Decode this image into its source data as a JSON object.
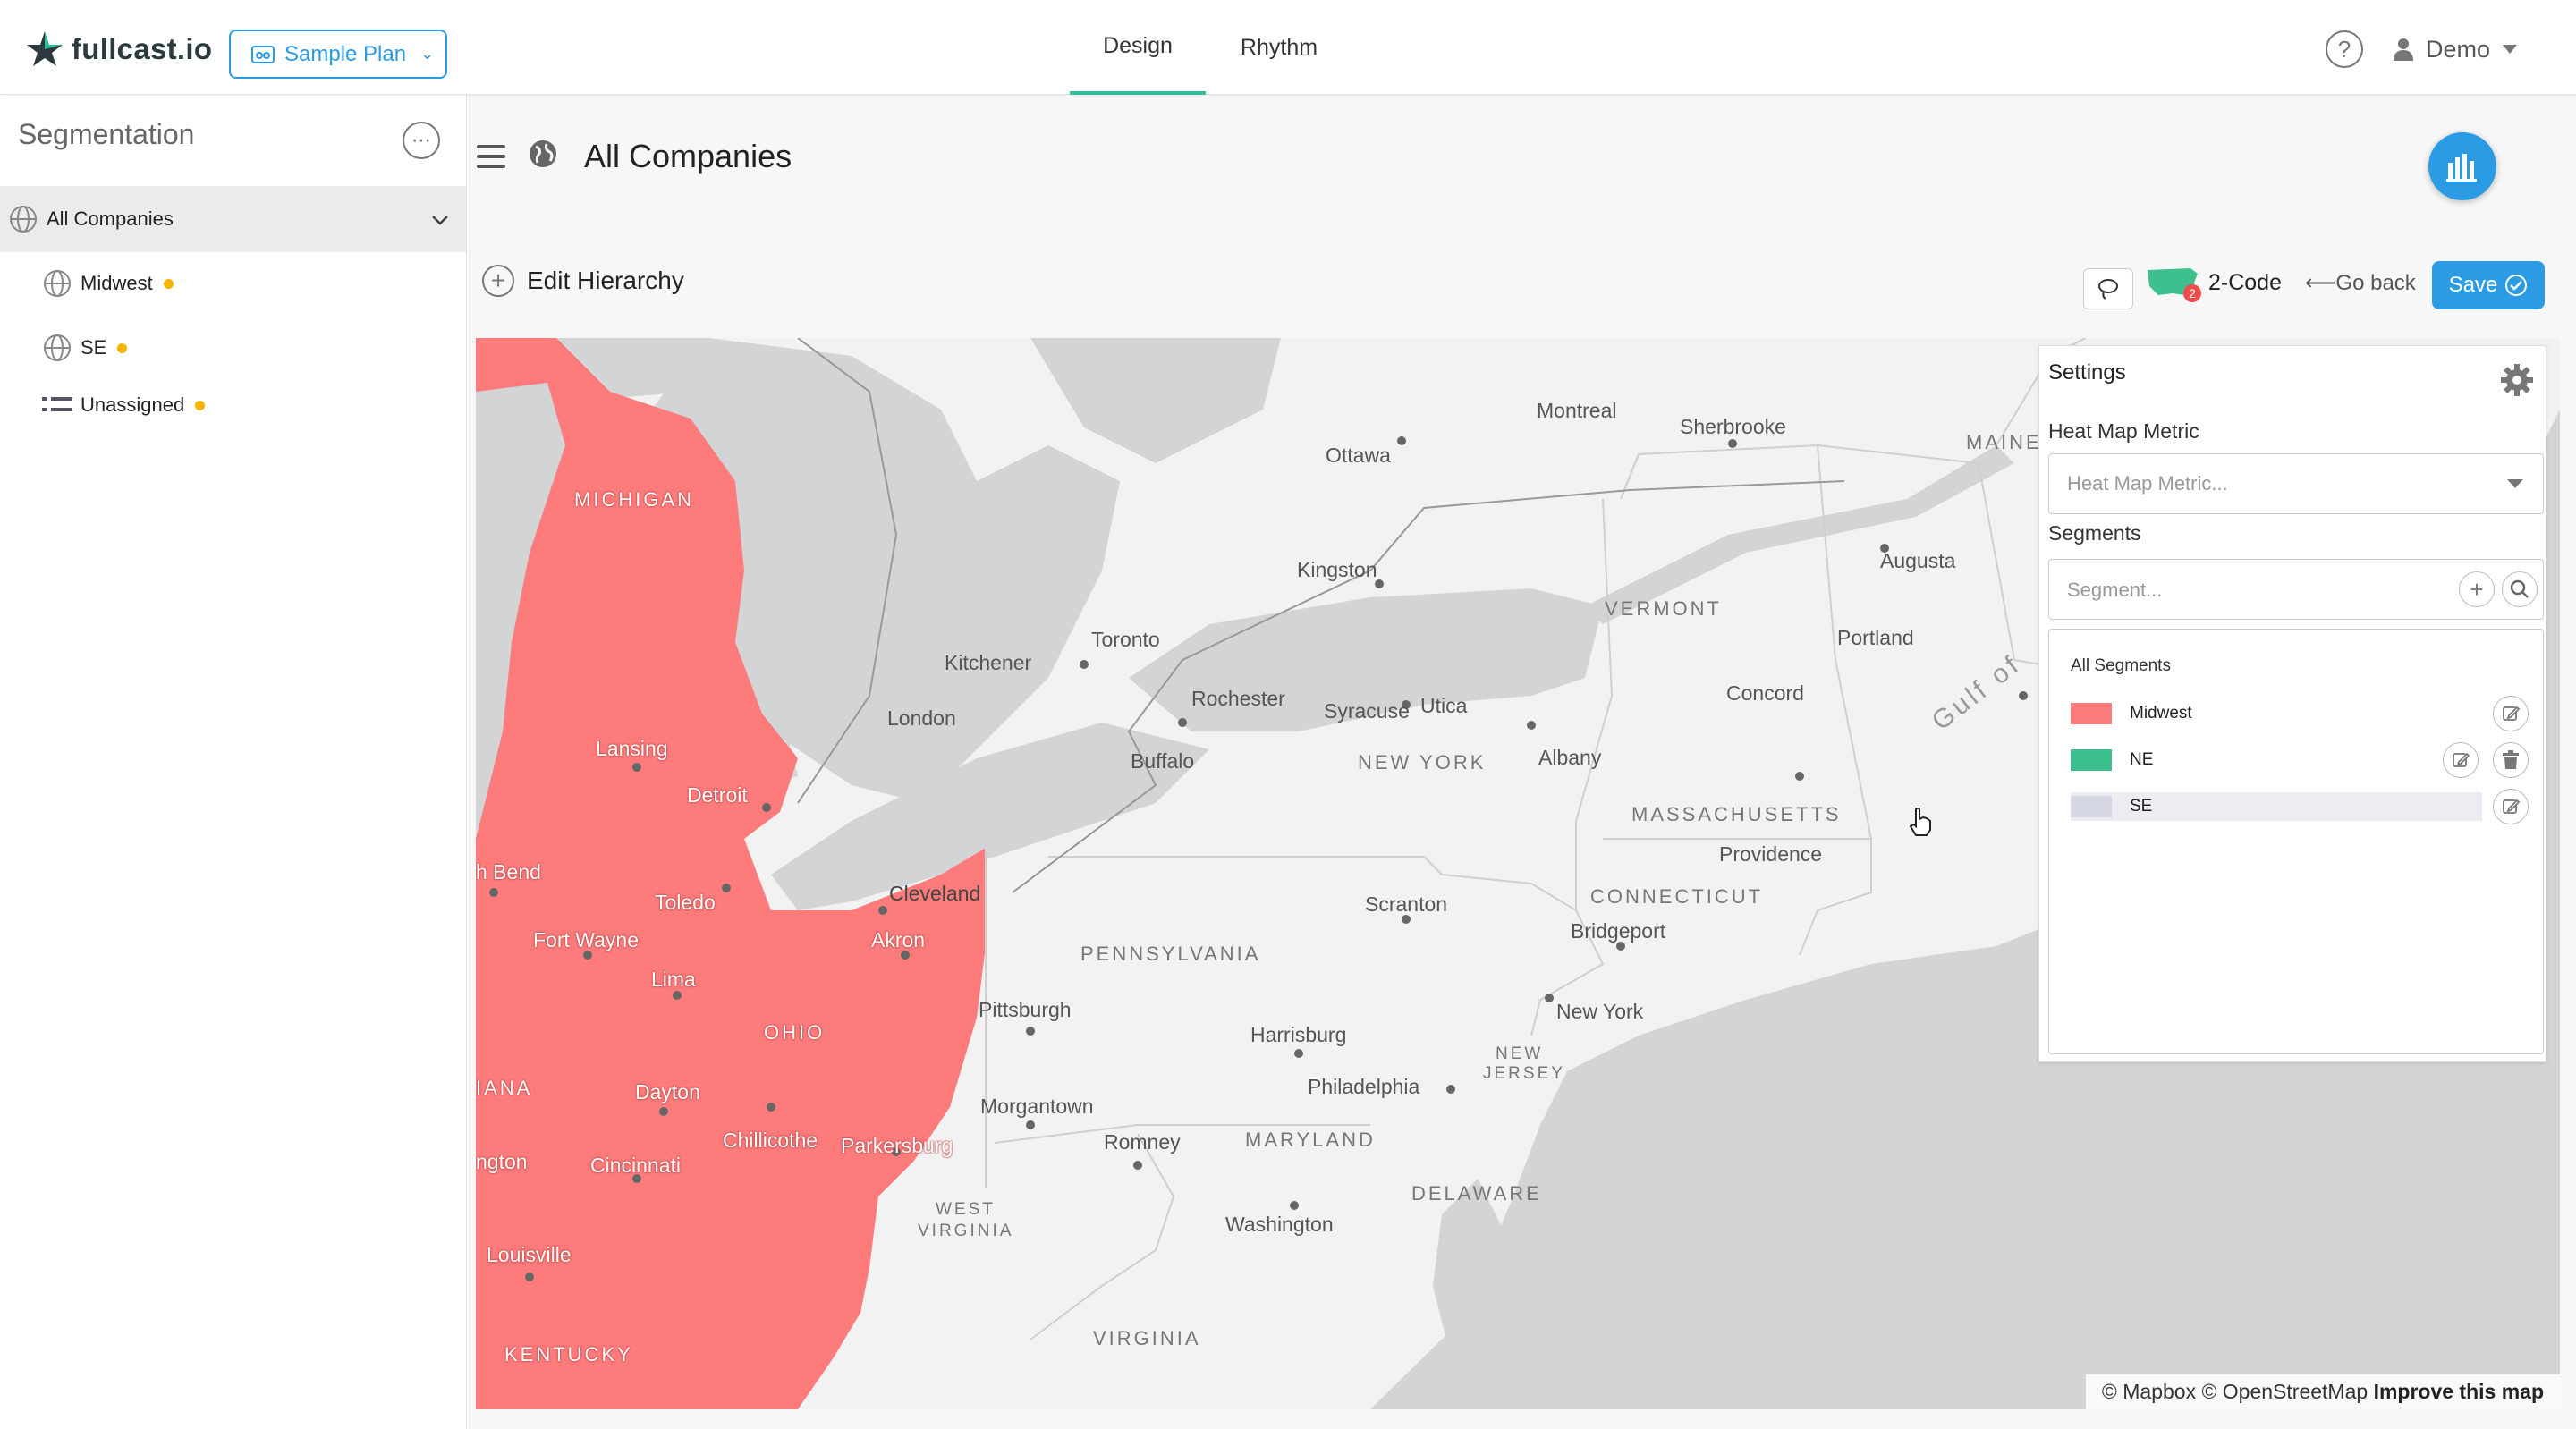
{
  "app": {
    "logo_text": "fullcast.io",
    "plan_label": "Sample Plan",
    "tabs": [
      {
        "label": "Design",
        "active": true
      },
      {
        "label": "Rhythm",
        "active": false
      }
    ],
    "help_glyph": "?",
    "user_name": "Demo",
    "accent_color": "#2b9be3",
    "tab_active_color": "#2fbf9a"
  },
  "sidebar": {
    "title": "Segmentation",
    "items": [
      {
        "label": "All Companies",
        "icon": "globe-icon",
        "active": true
      },
      {
        "label": "Midwest",
        "icon": "globe-icon",
        "status_color": "#f5b400"
      },
      {
        "label": "SE",
        "icon": "globe-icon",
        "status_color": "#f5b400"
      },
      {
        "label": "Unassigned",
        "icon": "list-icon",
        "status_color": "#f5b400"
      }
    ]
  },
  "main": {
    "title": "All Companies",
    "edit_hierarchy_label": "Edit Hierarchy",
    "two_code_label": "2-Code",
    "two_code_badge": "2",
    "go_back_label": "Go back",
    "save_label": "Save"
  },
  "map": {
    "labels": {
      "michigan": "MICHIGAN",
      "ohio": "OHIO",
      "indiana": "IANA",
      "kentucky": "KENTUCKY",
      "pennsylvania": "PENNSYLVANIA",
      "new_york": "NEW YORK",
      "massachusetts": "MASSACHUSETTS",
      "connecticut": "CONNECTICUT",
      "vermont": "VERMONT",
      "maine": "MAINE",
      "maryland": "MARYLAND",
      "delaware": "DELAWARE",
      "new_jersey_1": "NEW",
      "new_jersey_2": "JERSEY",
      "west_virginia_1": "WEST",
      "west_virginia_2": "VIRGINIA",
      "virginia": "VIRGINIA",
      "gulf": "Gulf of",
      "montreal": "Montreal",
      "ottawa": "Ottawa",
      "sherbrooke": "Sherbrooke",
      "augusta": "Augusta",
      "kingston": "Kingston",
      "toronto": "Toronto",
      "kitchener": "Kitchener",
      "london": "London",
      "rochester": "Rochester",
      "syracuse": "Syracuse",
      "utica": "Utica",
      "buffalo": "Buffalo",
      "albany": "Albany",
      "portland": "Portland",
      "concord": "Concord",
      "providence": "Providence",
      "lansing": "Lansing",
      "detroit": "Detroit",
      "south_bend": "h Bend",
      "toledo": "Toledo",
      "cleveland": "Cleveland",
      "akron": "Akron",
      "fort_wayne": "Fort Wayne",
      "lima": "Lima",
      "dayton": "Dayton",
      "chillicothe": "Chillicothe",
      "parkersburg": "Parkersburg",
      "indianapolis": "ngton",
      "cincinnati": "Cincinnati",
      "louisville": "Louisville",
      "scranton": "Scranton",
      "bridgeport": "Bridgeport",
      "new_york_city": "New York",
      "pittsburgh": "Pittsburgh",
      "harrisburg": "Harrisburg",
      "philadelphia": "Philadelphia",
      "morgantown": "Morgantown",
      "romney": "Romney",
      "washington": "Washington"
    },
    "attribution_1": "© Mapbox © OpenStreetMap",
    "attribution_2": "Improve this map",
    "midwest_color": "#fe7b7b",
    "water_color": "#d3d4d6",
    "land_color": "#f2f2f2"
  },
  "settings": {
    "title": "Settings",
    "heat_map_label": "Heat Map Metric",
    "heat_map_placeholder": "Heat Map Metric...",
    "segments_label": "Segments",
    "segment_placeholder": "Segment...",
    "all_segments_label": "All Segments",
    "segments": [
      {
        "name": "Midwest",
        "color": "#fe7b7b"
      },
      {
        "name": "NE",
        "color": "#3dc08e"
      },
      {
        "name": "SE",
        "color": "#d5d7e2"
      }
    ]
  }
}
